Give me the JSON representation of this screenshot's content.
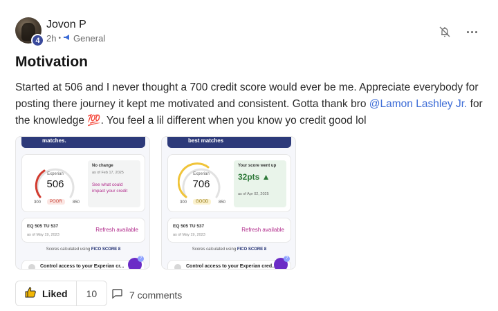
{
  "post": {
    "author": "Jovon P",
    "level": "4",
    "time": "2h",
    "separator": "•",
    "category": "General",
    "title": "Motivation",
    "body_part1": "Started at 506 and I never thought a 700 credit score would ever be me. Appreciate everybody for posting there journey it kept me motivated and consistent. Gotta thank bro ",
    "mention": "@Lamon Lashley Jr.",
    "body_part2": " for the knowledge 💯. You feel a lil different when you know yo credit good lol"
  },
  "screenshots": [
    {
      "banner": "matches.",
      "bureau": "Experian",
      "score": "506",
      "range_min": "300",
      "range_max": "850",
      "rating": "POOR",
      "info_heading": "No change",
      "info_sub": "as of Feb 17, 2025",
      "info_link": "See what could impact your credit",
      "fico_line": "EQ 505  TU 537",
      "fico_asof": "as of May 19, 2023",
      "refresh": "Refresh available",
      "scores_note": "Scores calculated using",
      "fico_brand": "FICO SCORE 8",
      "bottom_text": "Control access to your Experian cr..."
    },
    {
      "banner": "best matches",
      "bureau": "Experian",
      "score": "706",
      "range_min": "300",
      "range_max": "850",
      "rating": "GOOD",
      "info_heading": "Your score went up",
      "points": "32pts ▲",
      "info_sub": "as of Apr 02, 2025",
      "fico_line": "EQ 505  TU 537",
      "fico_asof": "as of May 19, 2023",
      "refresh": "Refresh available",
      "scores_note": "Scores calculated using",
      "fico_brand": "FICO SCORE 8",
      "bottom_text": "Control access to your Experian cred..."
    }
  ],
  "footer": {
    "like_label": "Liked",
    "like_count": "10",
    "comments": "7 comments"
  },
  "colors": {
    "accent_link": "#3b6bd6",
    "brand_navy": "#2d3a7a",
    "refresh_magenta": "#b0298a"
  },
  "icons": [
    "bell-off-icon",
    "more-icon",
    "megaphone-icon",
    "thumbs-up-icon",
    "comment-icon",
    "lock-icon",
    "chat-icon"
  ]
}
